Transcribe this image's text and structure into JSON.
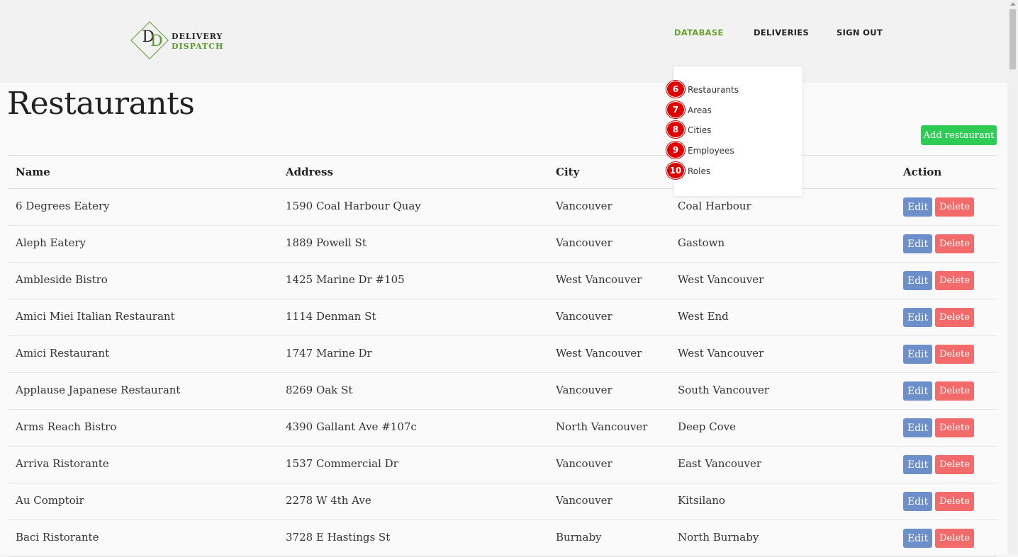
{
  "brand": {
    "line1": "DELIVERY",
    "line2": "DISPATCH",
    "monogram_1": "D",
    "monogram_2": "D",
    "accent_color": "#5a9a2a"
  },
  "nav": {
    "items": [
      "DATABASE",
      "DELIVERIES",
      "SIGN OUT"
    ],
    "active": "DATABASE"
  },
  "dropdown": {
    "items": [
      {
        "badge": "6",
        "label": "Restaurants"
      },
      {
        "badge": "7",
        "label": "Areas"
      },
      {
        "badge": "8",
        "label": "Cities"
      },
      {
        "badge": "9",
        "label": "Employees"
      },
      {
        "badge": "10",
        "label": "Roles"
      }
    ]
  },
  "page": {
    "title": "Restaurants",
    "add_button": "Add restaurant"
  },
  "table": {
    "headers": [
      "Name",
      "Address",
      "City",
      "",
      "Action"
    ],
    "edit_label": "Edit",
    "delete_label": "Delete",
    "rows": [
      {
        "name": "6 Degrees Eatery",
        "address": "1590 Coal Harbour Quay",
        "city": "Vancouver",
        "area": "Coal Harbour"
      },
      {
        "name": "Aleph Eatery",
        "address": "1889 Powell St",
        "city": "Vancouver",
        "area": "Gastown"
      },
      {
        "name": "Ambleside Bistro",
        "address": "1425 Marine Dr #105",
        "city": "West Vancouver",
        "area": "West Vancouver"
      },
      {
        "name": "Amici Miei Italian Restaurant",
        "address": "1114 Denman St",
        "city": "Vancouver",
        "area": "West End"
      },
      {
        "name": "Amici Restaurant",
        "address": "1747 Marine Dr",
        "city": "West Vancouver",
        "area": "West Vancouver"
      },
      {
        "name": "Applause Japanese Restaurant",
        "address": "8269 Oak St",
        "city": "Vancouver",
        "area": "South Vancouver"
      },
      {
        "name": "Arms Reach Bistro",
        "address": "4390 Gallant Ave #107c",
        "city": "North Vancouver",
        "area": "Deep Cove"
      },
      {
        "name": "Arriva Ristorante",
        "address": "1537 Commercial Dr",
        "city": "Vancouver",
        "area": "East Vancouver"
      },
      {
        "name": "Au Comptoir",
        "address": "2278 W 4th Ave",
        "city": "Vancouver",
        "area": "Kitsilano"
      },
      {
        "name": "Baci Ristorante",
        "address": "3728 E Hastings St",
        "city": "Burnaby",
        "area": "North Burnaby"
      }
    ]
  },
  "colors": {
    "nav_active": "#6aa12f",
    "add_button": "#2ecc55",
    "edit_button": "#6c8ec9",
    "delete_button": "#f26a6a",
    "badge": "#e00000"
  }
}
